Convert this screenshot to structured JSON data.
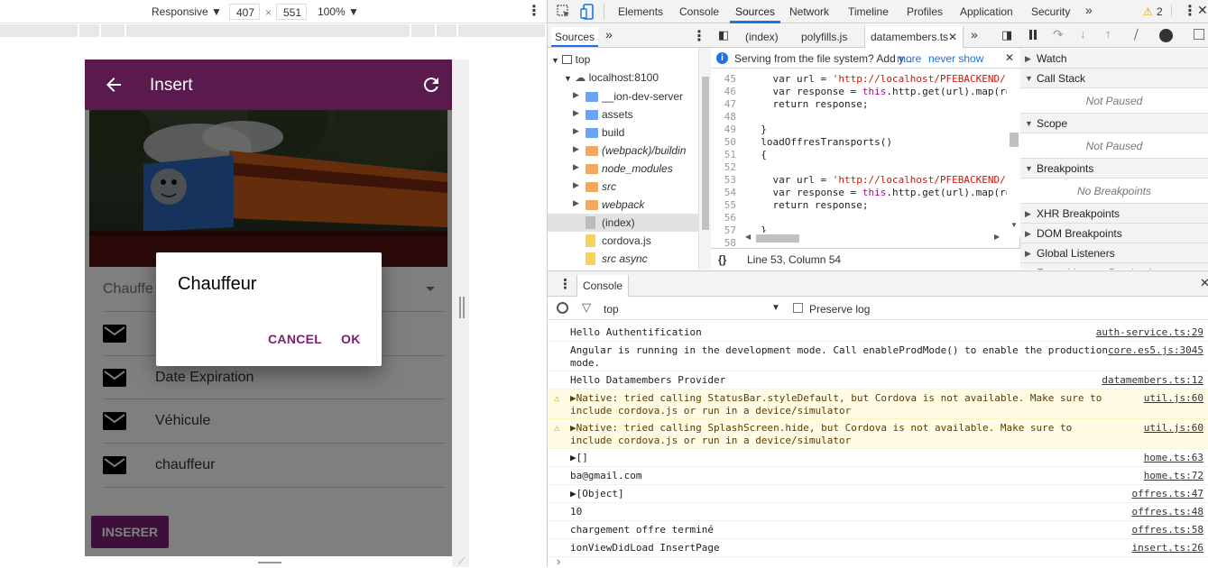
{
  "device_toolbar": {
    "mode": "Responsive",
    "width": "407",
    "times": "×",
    "height": "551",
    "zoom": "100%"
  },
  "app": {
    "title": "Insert",
    "select_placeholder": "Chauffe",
    "rows": [
      {
        "label": ""
      },
      {
        "label": "Date Expiration"
      },
      {
        "label": "Véhicule"
      },
      {
        "label": "chauffeur"
      }
    ],
    "insert_button": "INSERER",
    "dialog": {
      "title": "Chauffeur",
      "cancel": "CANCEL",
      "ok": "OK"
    }
  },
  "devtools": {
    "tabs": [
      "Elements",
      "Console",
      "Sources",
      "Network",
      "Timeline",
      "Profiles",
      "Application",
      "Security"
    ],
    "active_tab": "Sources",
    "warning_count": "2",
    "sources_panel_tab": "Sources",
    "file_tree": {
      "top": "top",
      "host": "localhost:8100",
      "items": [
        {
          "name": "__ion-dev-server",
          "type": "folder",
          "color": "#6aa5f2",
          "italic": false
        },
        {
          "name": "assets",
          "type": "folder",
          "color": "#6aa5f2",
          "italic": false
        },
        {
          "name": "build",
          "type": "folder",
          "color": "#6aa5f2",
          "italic": false
        },
        {
          "name": "(webpack)/buildin",
          "type": "folder",
          "color": "#f2a860",
          "italic": true
        },
        {
          "name": "node_modules",
          "type": "folder",
          "color": "#f2a860",
          "italic": true
        },
        {
          "name": "src",
          "type": "folder",
          "color": "#f2a860",
          "italic": true
        },
        {
          "name": "webpack",
          "type": "folder",
          "color": "#f2a860",
          "italic": true
        },
        {
          "name": "(index)",
          "type": "file",
          "color": "#bbbbbb",
          "italic": false
        },
        {
          "name": "cordova.js",
          "type": "file",
          "color": "#f7d25c",
          "italic": false
        },
        {
          "name": "src async",
          "type": "file",
          "color": "#f7d25c",
          "italic": true
        }
      ]
    },
    "editor_tabs": [
      "(index)",
      "polyfills.js",
      "datamembers.ts"
    ],
    "info_bar": {
      "text": "Serving from the file system? Add y...",
      "more": "more",
      "never": "never show"
    },
    "code_lines": [
      {
        "n": "45",
        "pre": "    var url = ",
        "str": "'http://localhost/PFEBACKEND/r",
        "post": ""
      },
      {
        "n": "46",
        "pre": "    var response = ",
        "kw": "this",
        "post": ".http.get(url).map(re"
      },
      {
        "n": "47",
        "pre": "    return response;",
        "post": ""
      },
      {
        "n": "48",
        "pre": "",
        "post": ""
      },
      {
        "n": "49",
        "pre": "  }",
        "post": ""
      },
      {
        "n": "50",
        "pre": "  loadOffresTransports()",
        "post": ""
      },
      {
        "n": "51",
        "pre": "  {",
        "post": ""
      },
      {
        "n": "52",
        "pre": "",
        "post": ""
      },
      {
        "n": "53",
        "pre": "    var url = ",
        "str": "'http://localhost/PFEBACKEND/r",
        "post": ""
      },
      {
        "n": "54",
        "pre": "    var response = ",
        "kw": "this",
        "post": ".http.get(url).map(re"
      },
      {
        "n": "55",
        "pre": "    return response;",
        "post": ""
      },
      {
        "n": "56",
        "pre": "",
        "post": ""
      },
      {
        "n": "57",
        "pre": "  }",
        "post": ""
      },
      {
        "n": "58",
        "pre": "",
        "post": ""
      }
    ],
    "status": "Line 53, Column 54",
    "debugger": {
      "sections": [
        {
          "title": "Watch",
          "body": ""
        },
        {
          "title": "Call Stack",
          "body": "Not Paused"
        },
        {
          "title": "Scope",
          "body": "Not Paused"
        },
        {
          "title": "Breakpoints",
          "body": "No Breakpoints"
        },
        {
          "title": "XHR Breakpoints",
          "body": ""
        },
        {
          "title": "DOM Breakpoints",
          "body": ""
        },
        {
          "title": "Global Listeners",
          "body": ""
        },
        {
          "title": "Event Listener Breakpoints",
          "body": ""
        }
      ]
    },
    "console": {
      "tab": "Console",
      "context": "top",
      "preserve_log": "Preserve log",
      "messages": [
        {
          "text": "Hello Authentification",
          "link": "auth-service.ts:29",
          "level": "log",
          "lines": 1
        },
        {
          "text": "Angular is running in the development mode. Call enableProdMode() to enable the production mode.",
          "link": "core.es5.js:3045",
          "level": "log",
          "lines": 2
        },
        {
          "text": "Hello Datamembers Provider",
          "link": "datamembers.ts:12",
          "level": "log",
          "lines": 1
        },
        {
          "text": "▶Native: tried calling StatusBar.styleDefault, but Cordova is not available. Make sure to include cordova.js or run in a device/simulator",
          "link": "util.js:60",
          "level": "warn",
          "lines": 2
        },
        {
          "text": "▶Native: tried calling SplashScreen.hide, but Cordova is not available. Make sure to include cordova.js or run in a device/simulator",
          "link": "util.js:60",
          "level": "warn",
          "lines": 2
        },
        {
          "text": "▶[]",
          "link": "home.ts:63",
          "level": "log",
          "lines": 1
        },
        {
          "text": "ba@gmail.com",
          "link": "home.ts:72",
          "level": "log",
          "lines": 1
        },
        {
          "text": "▶[Object]",
          "link": "offres.ts:47",
          "level": "log",
          "lines": 1
        },
        {
          "text": "10",
          "link": "offres.ts:48",
          "level": "log",
          "lines": 1
        },
        {
          "text": "chargement offre terminé",
          "link": "offres.ts:58",
          "level": "log",
          "lines": 1
        },
        {
          "text": "ionViewDidLoad InsertPage",
          "link": "insert.ts:26",
          "level": "log",
          "lines": 1
        }
      ]
    }
  }
}
